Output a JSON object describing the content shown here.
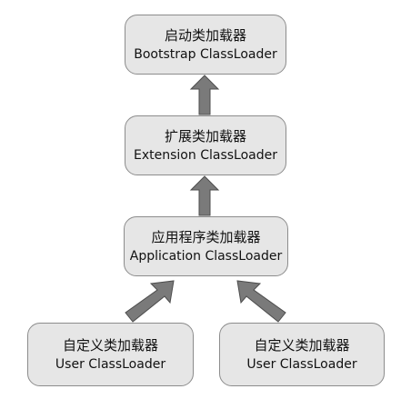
{
  "nodes": {
    "bootstrap": {
      "zh": "启动类加载器",
      "en": "Bootstrap ClassLoader"
    },
    "extension": {
      "zh": "扩展类加载器",
      "en": "Extension ClassLoader"
    },
    "application": {
      "zh": "应用程序类加载器",
      "en": "Application ClassLoader"
    },
    "user_left": {
      "zh": "自定义类加载器",
      "en": "User ClassLoader"
    },
    "user_right": {
      "zh": "自定义类加载器",
      "en": "User ClassLoader"
    }
  },
  "colors": {
    "box_fill": "#e6e6e6",
    "box_border": "#8c8c8c",
    "arrow_fill": "#7a7a7a",
    "arrow_outline": "#4d4d4d"
  }
}
